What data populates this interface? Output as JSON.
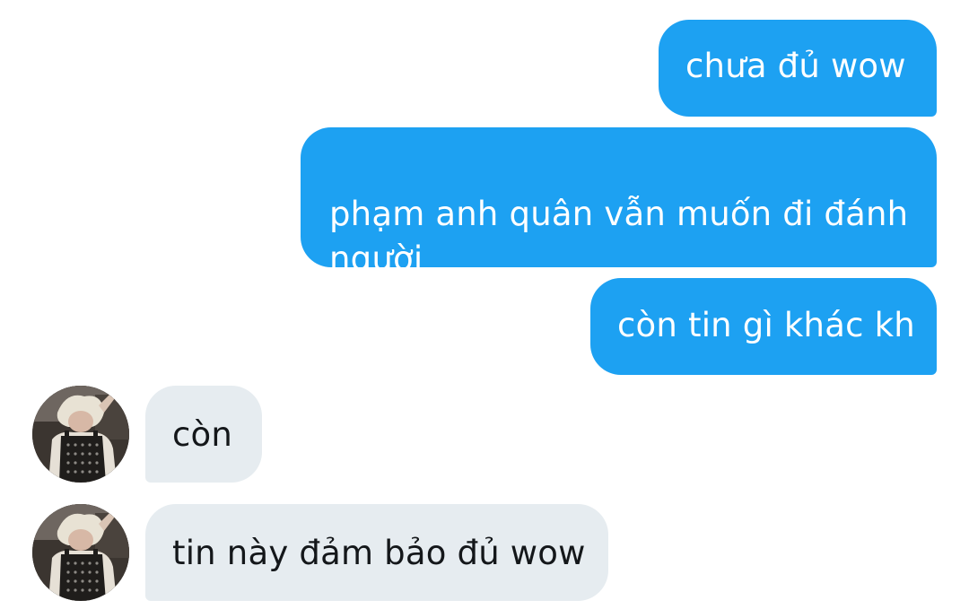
{
  "conversation": {
    "messages": [
      {
        "direction": "sent",
        "text": "chưa đủ wow"
      },
      {
        "direction": "sent",
        "text": "phạm anh quân vẫn muốn đi đánh\nngười"
      },
      {
        "direction": "sent",
        "text": "còn tin gì khác kh"
      },
      {
        "direction": "received",
        "text": "còn"
      },
      {
        "direction": "received",
        "text": "tin này đảm bảo đủ wow"
      }
    ]
  },
  "colors": {
    "sent_bubble": "#1da1f2",
    "sent_text": "#ffffff",
    "received_bubble": "#e6ecf0",
    "received_text": "#14171a",
    "background": "#ffffff"
  },
  "icons": {
    "avatar": "contact-avatar-photo"
  }
}
